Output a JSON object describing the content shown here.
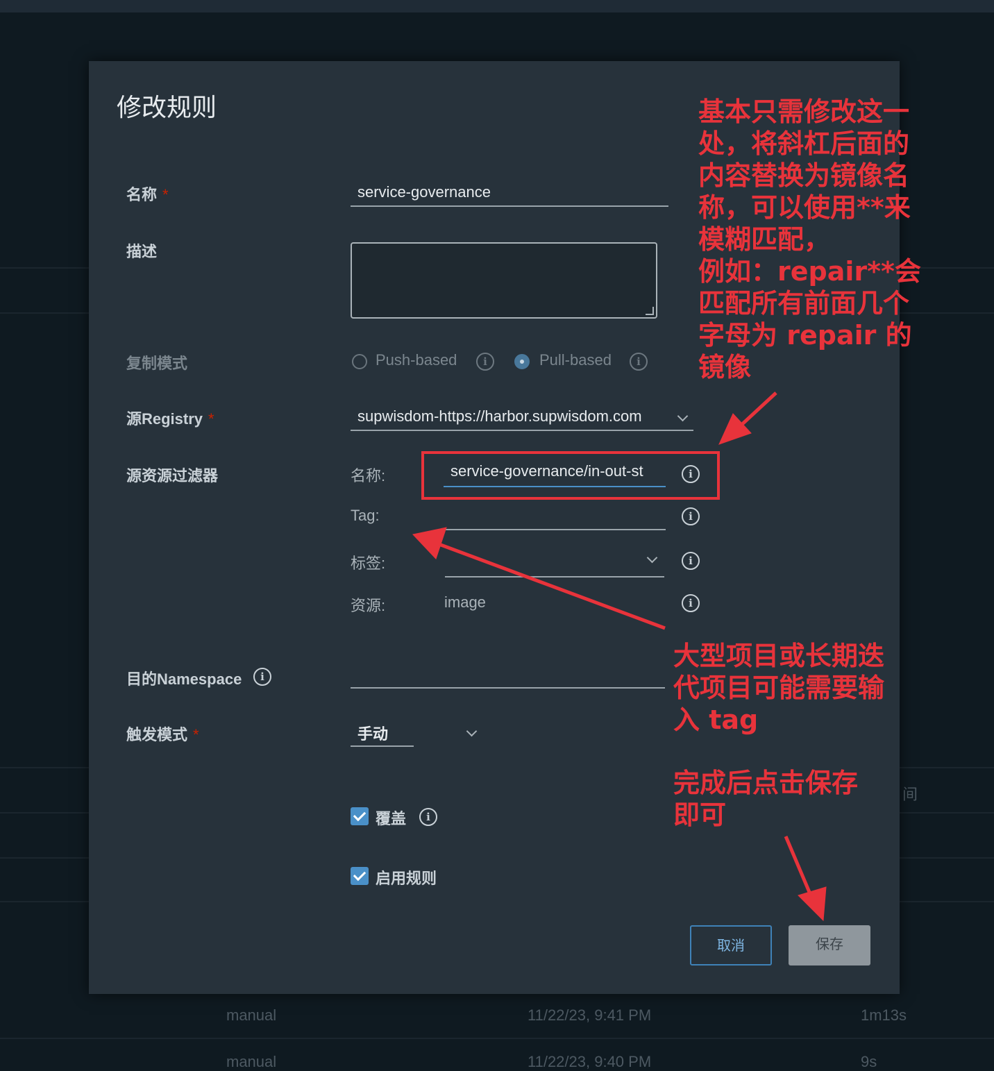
{
  "modal": {
    "title": "修改规则",
    "fields": {
      "name_label": "名称",
      "name_value": "service-governance",
      "description_label": "描述",
      "replication_mode_label": "复制模式",
      "push_based_label": "Push-based",
      "pull_based_label": "Pull-based",
      "source_registry_label": "源Registry",
      "source_registry_value": "supwisdom-https://harbor.supwisdom.com",
      "source_filter_label": "源资源过滤器",
      "filter_name_label": "名称:",
      "filter_name_value": "service-governance/in-out-st",
      "filter_tag_label": "Tag:",
      "filter_tag_value": "",
      "filter_labels_label": "标签:",
      "filter_resource_label": "资源:",
      "filter_resource_value": "image",
      "dest_namespace_label": "目的Namespace",
      "dest_namespace_value": "",
      "trigger_mode_label": "触发模式",
      "trigger_mode_value": "手动",
      "override_label": "覆盖",
      "enable_rule_label": "启用规则",
      "required_mark": "*"
    },
    "buttons": {
      "cancel": "取消",
      "save": "保存"
    },
    "state": {
      "replication_mode": "Pull-based",
      "override_checked": true,
      "enable_rule_checked": true
    }
  },
  "background": {
    "header_partial": "间",
    "rows": [
      {
        "trigger": "manual",
        "time": "11/22/23, 9:41 PM",
        "duration": "1m13s"
      },
      {
        "trigger": "manual",
        "time": "11/22/23, 9:40 PM",
        "duration": "9s"
      }
    ]
  },
  "annotations": {
    "note_filter": "基本只需修改这一处，将斜杠后面的内容替换为镜像名称，可以使用**来模糊匹配，\n例如：repair**会匹配所有前面几个字母为 repair 的镜像",
    "note_filter_lines": [
      "基本只需修改这一",
      "处，将斜杠后面的",
      "内容替换为镜像名",
      "称，可以使用**来",
      "模糊匹配，",
      "例如：repair**会",
      "匹配所有前面几个",
      "字母为 repair 的",
      "镜像"
    ],
    "note_tag_lines": [
      "大型项目或长期迭",
      "代项目可能需要输",
      "入 tag"
    ],
    "note_save_lines": [
      "完成后点击保存",
      "即可"
    ],
    "color": "#e8333b"
  }
}
